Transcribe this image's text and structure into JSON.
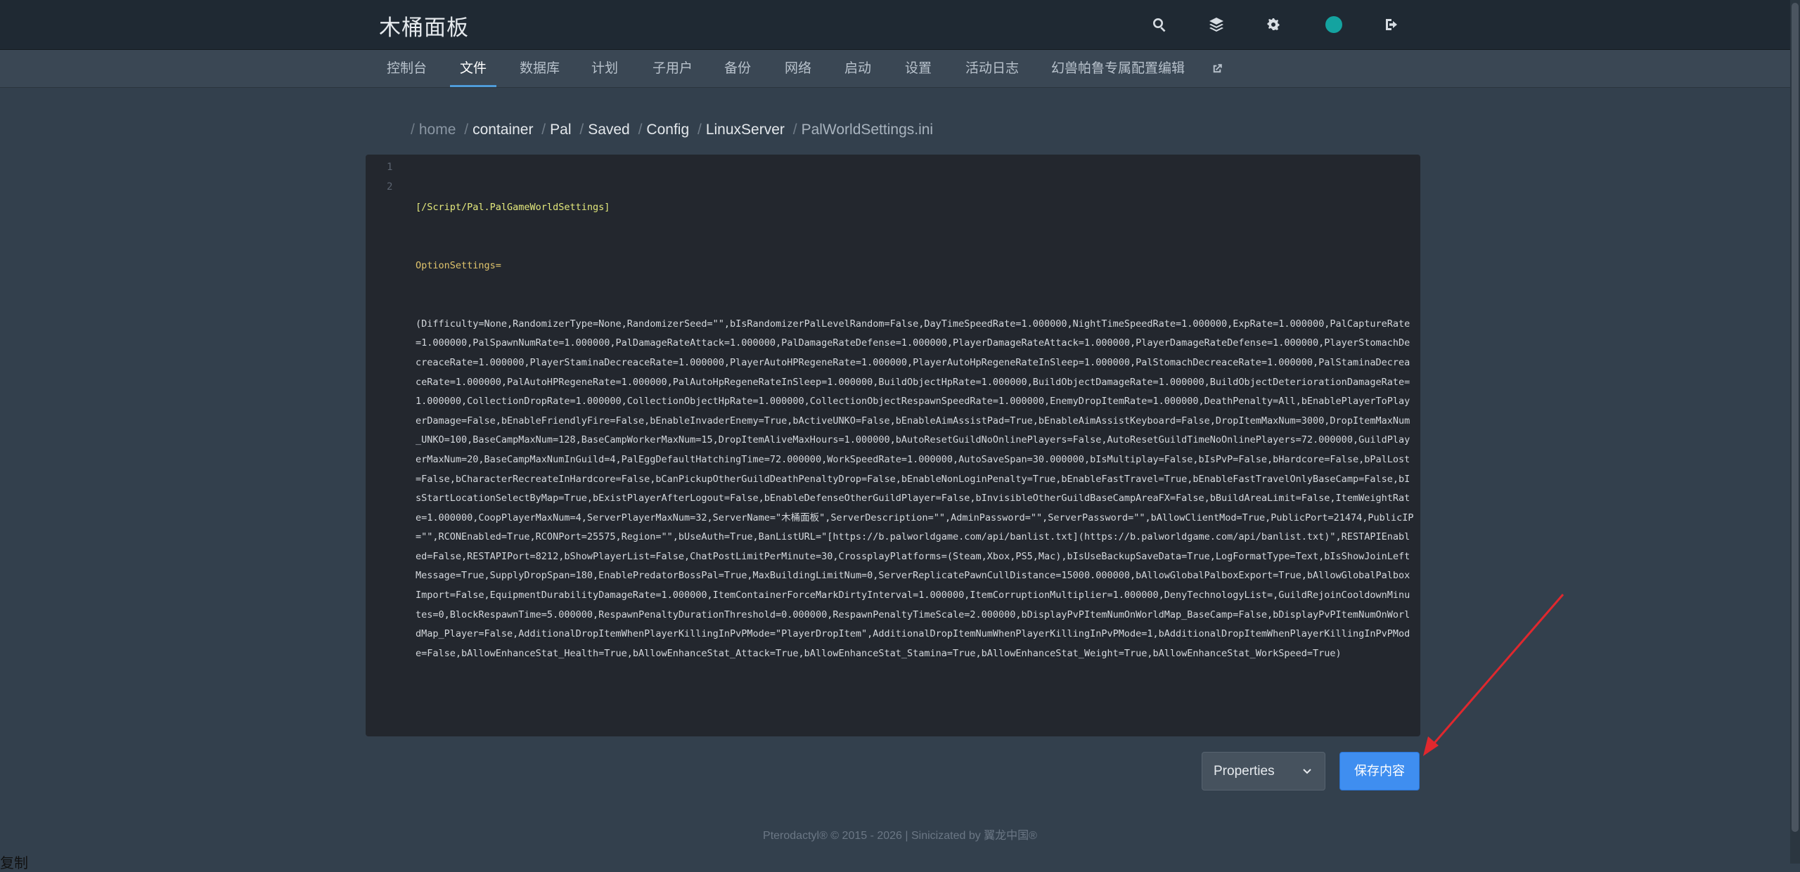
{
  "header": {
    "brand": "木桶面板",
    "icons": [
      "search-icon",
      "layers-icon",
      "cogs-icon",
      "avatar",
      "logout-icon"
    ]
  },
  "nav": {
    "items": [
      {
        "label": "控制台",
        "active": false
      },
      {
        "label": "文件",
        "active": true
      },
      {
        "label": "数据库",
        "active": false
      },
      {
        "label": "计划",
        "active": false
      },
      {
        "label": "子用户",
        "active": false
      },
      {
        "label": "备份",
        "active": false
      },
      {
        "label": "网络",
        "active": false
      },
      {
        "label": "启动",
        "active": false
      },
      {
        "label": "设置",
        "active": false
      },
      {
        "label": "活动日志",
        "active": false
      },
      {
        "label": "幻兽帕鲁专属配置编辑",
        "active": false
      }
    ]
  },
  "breadcrumb": {
    "home": "home",
    "parts": [
      "container",
      "Pal",
      "Saved",
      "Config",
      "LinuxServer"
    ],
    "current": "PalWorldSettings.ini"
  },
  "editor": {
    "line_numbers": [
      "1",
      "2"
    ],
    "line1": "[/Script/Pal.PalGameWorldSettings]",
    "line2_key": "OptionSettings=",
    "line2_value": "(Difficulty=None,RandomizerType=None,RandomizerSeed=\"\",bIsRandomizerPalLevelRandom=False,DayTimeSpeedRate=1.000000,NightTimeSpeedRate=1.000000,ExpRate=1.000000,PalCaptureRate=1.000000,PalSpawnNumRate=1.000000,PalDamageRateAttack=1.000000,PalDamageRateDefense=1.000000,PlayerDamageRateAttack=1.000000,PlayerDamageRateDefense=1.000000,PlayerStomachDecreaceRate=1.000000,PlayerStaminaDecreaceRate=1.000000,PlayerAutoHPRegeneRate=1.000000,PlayerAutoHpRegeneRateInSleep=1.000000,PalStomachDecreaceRate=1.000000,PalStaminaDecreaceRate=1.000000,PalAutoHPRegeneRate=1.000000,PalAutoHpRegeneRateInSleep=1.000000,BuildObjectHpRate=1.000000,BuildObjectDamageRate=1.000000,BuildObjectDeteriorationDamageRate=1.000000,CollectionDropRate=1.000000,CollectionObjectHpRate=1.000000,CollectionObjectRespawnSpeedRate=1.000000,EnemyDropItemRate=1.000000,DeathPenalty=All,bEnablePlayerToPlayerDamage=False,bEnableFriendlyFire=False,bEnableInvaderEnemy=True,bActiveUNKO=False,bEnableAimAssistPad=True,bEnableAimAssistKeyboard=False,DropItemMaxNum=3000,DropItemMaxNum_UNKO=100,BaseCampMaxNum=128,BaseCampWorkerMaxNum=15,DropItemAliveMaxHours=1.000000,bAutoResetGuildNoOnlinePlayers=False,AutoResetGuildTimeNoOnlinePlayers=72.000000,GuildPlayerMaxNum=20,BaseCampMaxNumInGuild=4,PalEggDefaultHatchingTime=72.000000,WorkSpeedRate=1.000000,AutoSaveSpan=30.000000,bIsMultiplay=False,bIsPvP=False,bHardcore=False,bPalLost=False,bCharacterRecreateInHardcore=False,bCanPickupOtherGuildDeathPenaltyDrop=False,bEnableNonLoginPenalty=True,bEnableFastTravel=True,bEnableFastTravelOnlyBaseCamp=False,bIsStartLocationSelectByMap=True,bExistPlayerAfterLogout=False,bEnableDefenseOtherGuildPlayer=False,bInvisibleOtherGuildBaseCampAreaFX=False,bBuildAreaLimit=False,ItemWeightRate=1.000000,CoopPlayerMaxNum=4,ServerPlayerMaxNum=32,ServerName=\"木桶面板\",ServerDescription=\"\",AdminPassword=\"\",ServerPassword=\"\",bAllowClientMod=True,PublicPort=21474,PublicIP=\"\",RCONEnabled=True,RCONPort=25575,Region=\"\",bUseAuth=True,BanListURL=\"[https://b.palworldgame.com/api/banlist.txt](https://b.palworldgame.com/api/banlist.txt)\",RESTAPIEnabled=False,RESTAPIPort=8212,bShowPlayerList=False,ChatPostLimitPerMinute=30,CrossplayPlatforms=(Steam,Xbox,PS5,Mac),bIsUseBackupSaveData=True,LogFormatType=Text,bIsShowJoinLeftMessage=True,SupplyDropSpan=180,EnablePredatorBossPal=True,MaxBuildingLimitNum=0,ServerReplicatePawnCullDistance=15000.000000,bAllowGlobalPalboxExport=True,bAllowGlobalPalboxImport=False,EquipmentDurabilityDamageRate=1.000000,ItemContainerForceMarkDirtyInterval=1.000000,ItemCorruptionMultiplier=1.000000,DenyTechnologyList=,GuildRejoinCooldownMinutes=0,BlockRespawnTime=5.000000,RespawnPenaltyDurationThreshold=0.000000,RespawnPenaltyTimeScale=2.000000,bDisplayPvPItemNumOnWorldMap_BaseCamp=False,bDisplayPvPItemNumOnWorldMap_Player=False,AdditionalDropItemWhenPlayerKillingInPvPMode=\"PlayerDropItem\",AdditionalDropItemNumWhenPlayerKillingInPvPMode=1,bAdditionalDropItemWhenPlayerKillingInPvPMode=False,bAllowEnhanceStat_Health=True,bAllowEnhanceStat_Attack=True,bAllowEnhanceStat_Stamina=True,bAllowEnhanceStat_Weight=True,bAllowEnhanceStat_WorkSpeed=True)"
  },
  "controls": {
    "mode_label": "Properties",
    "save_label": "保存内容"
  },
  "footer": {
    "copyright": "Pterodactyl® © 2015 - 2026 | ",
    "link": "Sinicizated by 翼龙中国®"
  },
  "corner_text": "复制",
  "colors": {
    "header_bg": "#1f2933",
    "nav_bg": "#3a4754",
    "page_bg": "#33404d",
    "editor_bg": "#23272e",
    "accent": "#3f8ef0",
    "annotation": "#e0282e"
  }
}
